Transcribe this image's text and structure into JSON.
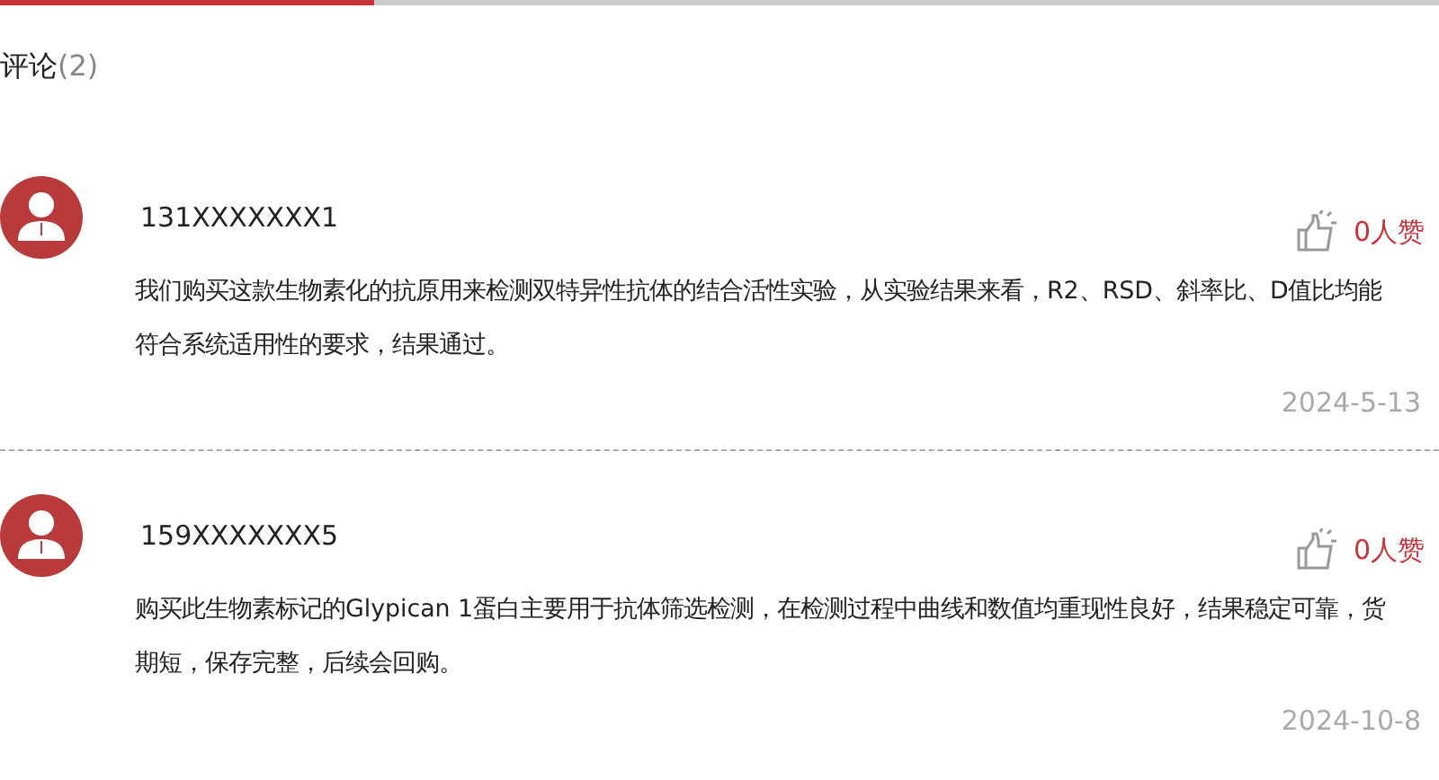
{
  "tabs_indicator": {
    "level": 0.26
  },
  "heading": {
    "title": "评论",
    "count": "(2)"
  },
  "comments": [
    {
      "user": "131XXXXXXX1",
      "likes": "0人赞",
      "text": "我们购买这款生物素化的抗原用来检测双特异性抗体的结合活性实验，从实验结果来看，R2、RSD、斜率比、D值比均能符合系统适用性的要求，结果通过。",
      "date": "2024-5-13"
    },
    {
      "user": "159XXXXXXX5",
      "likes": "0人赞",
      "text": "购买此生物素标记的Glypican 1蛋白主要用于抗体筛选检测，在检测过程中曲线和数值均重现性良好，结果稳定可靠，货期短，保存完整，后续会回购。",
      "date": "2024-10-8"
    }
  ]
}
